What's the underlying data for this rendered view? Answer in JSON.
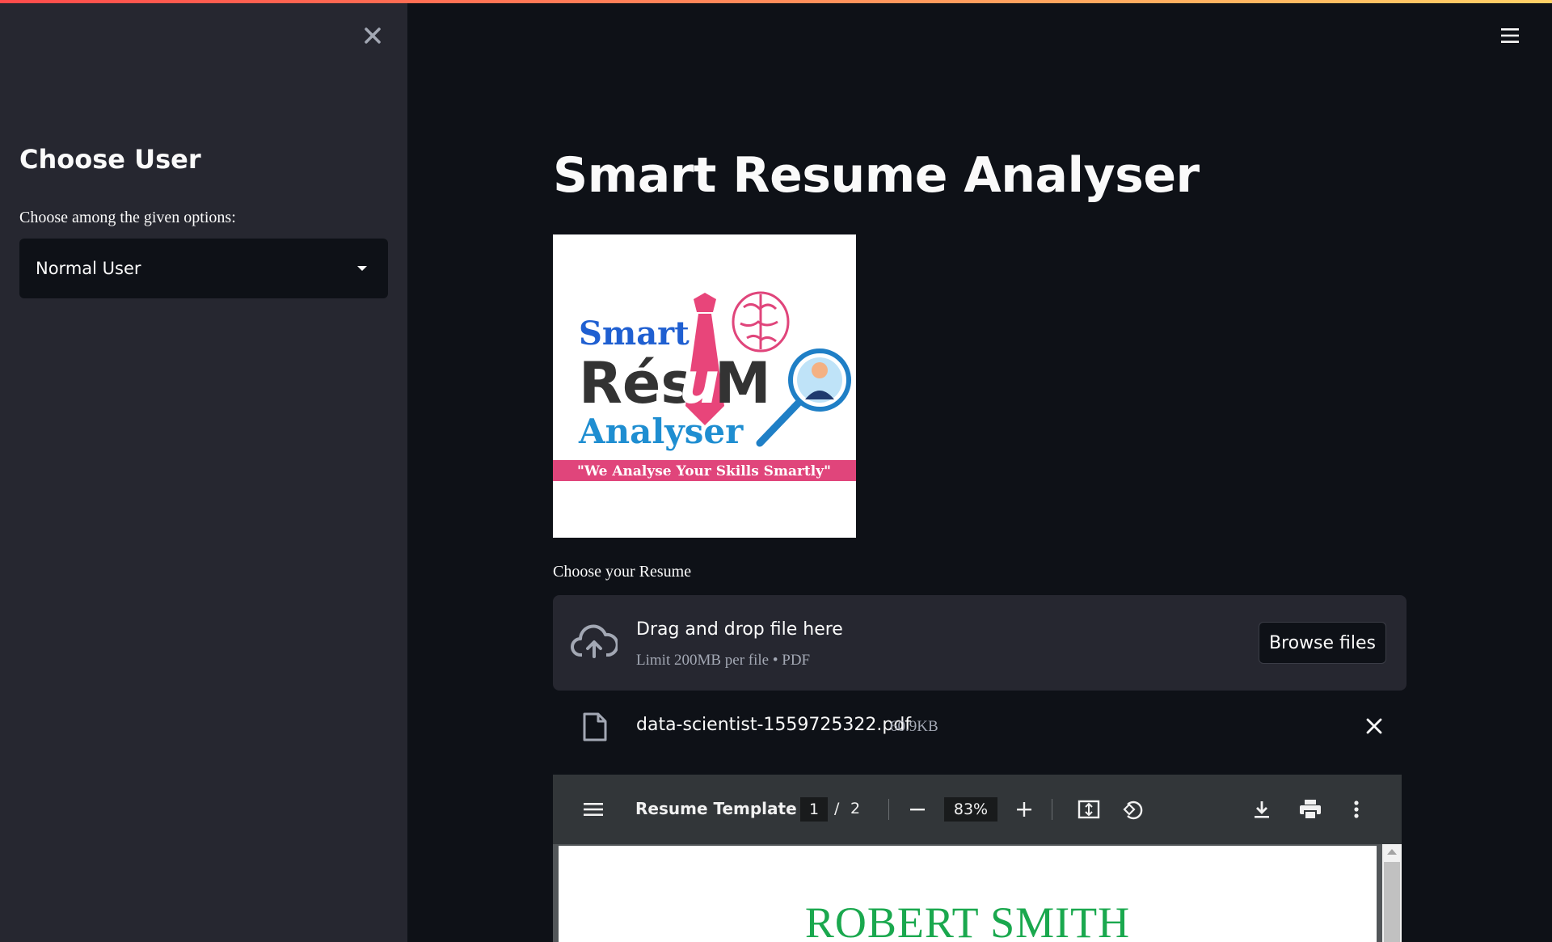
{
  "sidebar": {
    "title": "Choose User",
    "select_label": "Choose among the given options:",
    "selected_option": "Normal User"
  },
  "main": {
    "title": "Smart Resume Analyser",
    "logo": {
      "line1": "Smart",
      "line2_a": "Rés",
      "line2_b": "u",
      "line2_c": "M",
      "line3": "Analyser",
      "tagline": "\"We Analyse Your Skills Smartly\""
    },
    "uploader": {
      "label": "Choose your Resume",
      "drop_text": "Drag and drop file here",
      "limit_text": "Limit 200MB per file • PDF",
      "browse_label": "Browse files"
    },
    "uploaded_file": {
      "name": "data-scientist-1559725322.pdf",
      "size": "60.9KB"
    },
    "pdf_viewer": {
      "title": "Resume Template",
      "current_page": "1",
      "page_separator": "/",
      "total_pages": "2",
      "zoom": "83%",
      "content_heading": "ROBERT SMITH"
    }
  },
  "colors": {
    "background": "#0e1117",
    "sidebar": "#262730",
    "accent_gradient": [
      "#ff4b4b",
      "#ffd166"
    ],
    "resume_heading": "#1aa84e"
  },
  "icons": [
    "close-icon",
    "hamburger-menu-icon",
    "chevron-down-icon",
    "cloud-upload-icon",
    "file-icon",
    "close-icon",
    "pdf-menu-icon",
    "zoom-out-icon",
    "zoom-in-icon",
    "fit-page-icon",
    "rotate-icon",
    "download-icon",
    "print-icon",
    "more-options-icon"
  ]
}
